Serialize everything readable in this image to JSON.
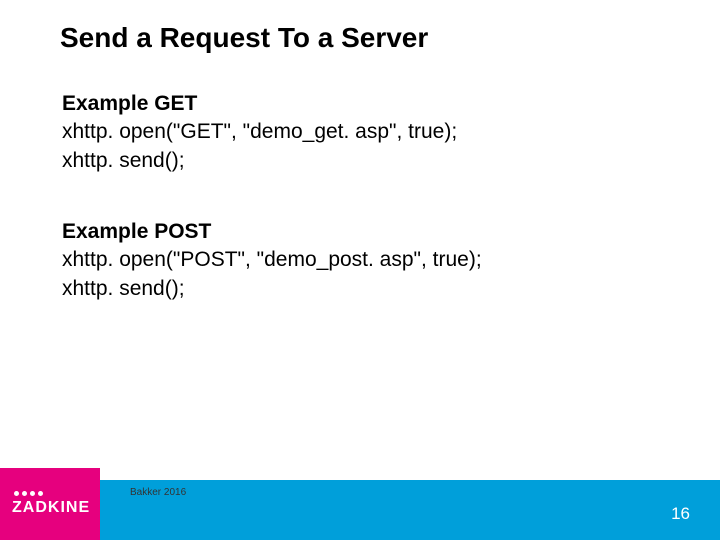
{
  "title": "Send a Request To a Server",
  "get_block": {
    "label": "Example  GET",
    "line1": "xhttp. open(\"GET\", \"demo_get. asp\", true);",
    "line2": "xhttp. send();"
  },
  "post_block": {
    "label": "Example  POST",
    "line1": "xhttp. open(\"POST\", \"demo_post. asp\", true);",
    "line2": "xhttp. send();"
  },
  "logo_text": "ZADKINE",
  "author": "Bakker 2016",
  "page_number": "16",
  "colors": {
    "footer_bar": "#009fda",
    "logo_block": "#e6007e"
  }
}
